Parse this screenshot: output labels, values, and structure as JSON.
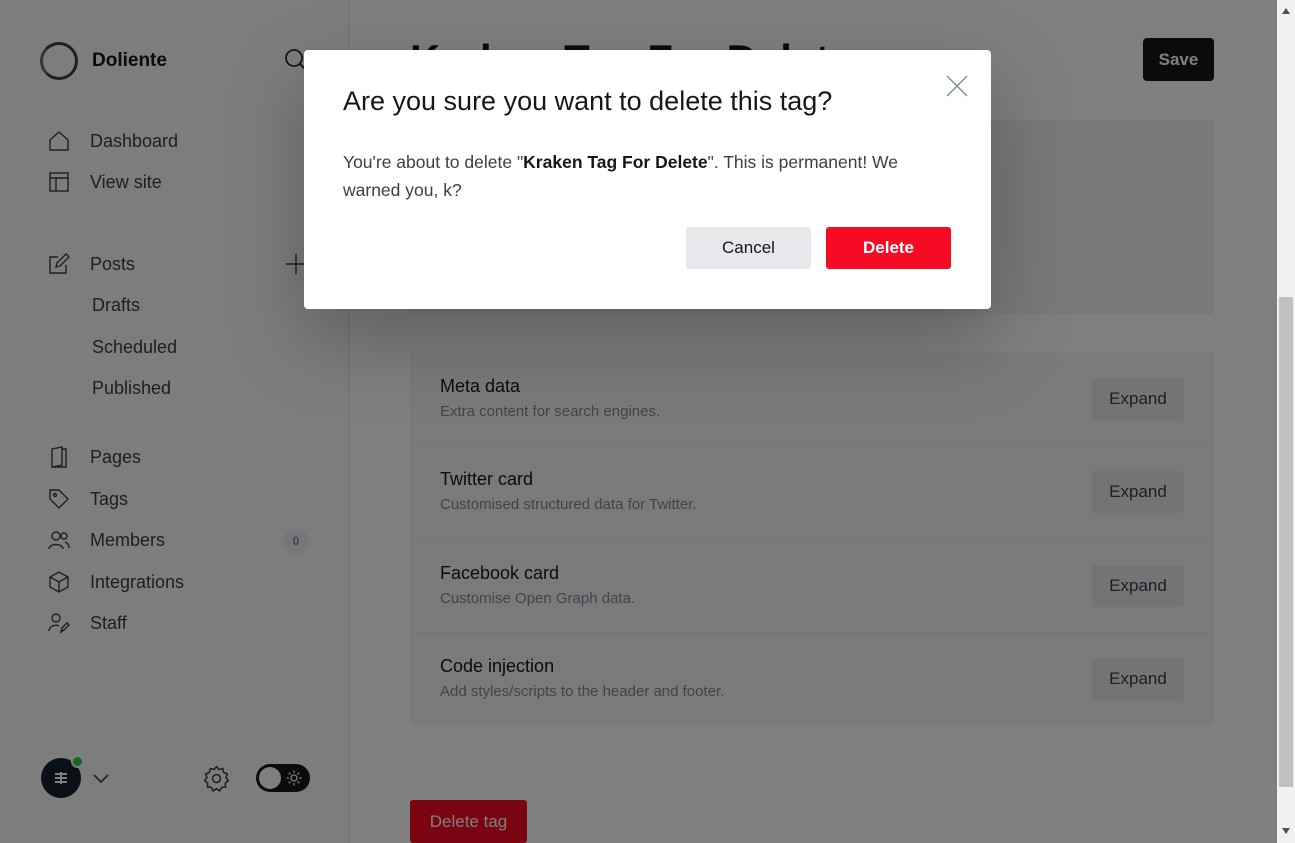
{
  "sidebar": {
    "brand_name": "Doliente",
    "nav": {
      "dashboard": "Dashboard",
      "view_site": "View site",
      "posts": "Posts",
      "drafts": "Drafts",
      "scheduled": "Scheduled",
      "published": "Published",
      "pages": "Pages",
      "tags": "Tags",
      "members": "Members",
      "members_count": "0",
      "integrations": "Integrations",
      "staff": "Staff"
    },
    "user_status": "online"
  },
  "header": {
    "title": "Kraken Tag For Delete",
    "save_label": "Save"
  },
  "settings": {
    "rows": [
      {
        "title": "Meta data",
        "desc": "Extra content for search engines.",
        "action": "Expand"
      },
      {
        "title": "Twitter card",
        "desc": "Customised structured data for Twitter.",
        "action": "Expand"
      },
      {
        "title": "Facebook card",
        "desc": "Customise Open Graph data.",
        "action": "Expand"
      },
      {
        "title": "Code injection",
        "desc": "Add styles/scripts to the header and footer.",
        "action": "Expand"
      }
    ],
    "delete_tag_label": "Delete tag"
  },
  "modal": {
    "title": "Are you sure you want to delete this tag?",
    "body_prefix": "You're about to delete \"",
    "tag_name": "Kraken Tag For Delete",
    "body_suffix": "\". This is permanent! We warned you, k?",
    "cancel_label": "Cancel",
    "delete_label": "Delete"
  },
  "colors": {
    "danger": "#f50b23",
    "primary_dark": "#15171a",
    "online": "#30cf43"
  }
}
